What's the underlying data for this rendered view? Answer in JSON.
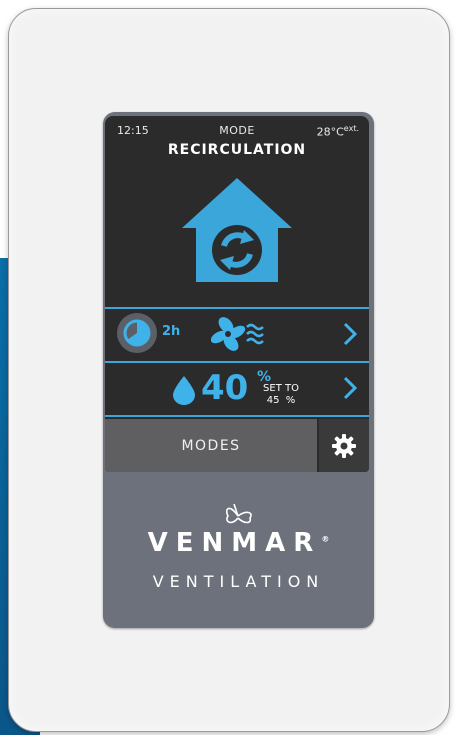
{
  "status": {
    "time": "12:15",
    "label": "MODE",
    "temp": "28°C",
    "temp_suffix": "ext."
  },
  "mode": {
    "title": "RECIRCULATION",
    "icon": "recirculation-house-icon"
  },
  "timer_row": {
    "duration": "2h",
    "icons": [
      "timer-icon",
      "fan-icon",
      "airflow-icon",
      "chevron-right-icon"
    ]
  },
  "humidity_row": {
    "value": "40",
    "unit": "%",
    "set_to_label": "SET TO",
    "set_to_value": "45  %",
    "icons": [
      "water-drop-icon",
      "chevron-right-icon"
    ]
  },
  "bottom_bar": {
    "modes_label": "MODES",
    "settings_icon": "gear-icon"
  },
  "brand": {
    "name": "VENMAR",
    "registered": "®",
    "subtitle": "VENTILATION",
    "logo_icon": "butterfly-icon"
  },
  "colors": {
    "accent": "#3fb2ea",
    "screen_bg": "#2b2b2c",
    "bezel": "#6c717b",
    "plate": "#f2f2f2",
    "wall_blue": "#0a6ea8"
  }
}
